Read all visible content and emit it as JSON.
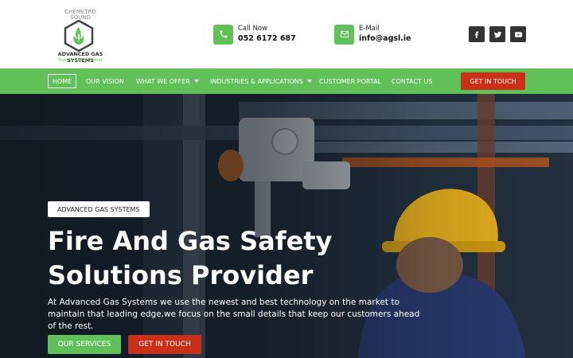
{
  "logo": {
    "badge_text": "CHEMETRO SOUND",
    "name": "ADVANCED GAS SYSTEMS",
    "tagline": "Trusted Safety Partner"
  },
  "contact": {
    "phone_label": "Call Now",
    "phone_value": "052 6172 687",
    "email_label": "E-Mail",
    "email_value": "info@agsl.ie"
  },
  "socials": [
    "facebook-icon",
    "twitter-icon",
    "youtube-icon"
  ],
  "nav": {
    "items": [
      "HOME",
      "OUR VISION",
      "WHAT WE OFFER",
      "INDUSTRIES & APPLICATIONS",
      "CUSTOMER PORTAL",
      "CONTACT US"
    ],
    "cta": "GET IN TOUCH"
  },
  "hero": {
    "badge": "ADVANCED GAS SYSTEMS",
    "title": "Fire And Gas Safety Solutions Provider",
    "subtitle": "At Advanced Gas Systems we use the newest and best technology on the market to maintain that leading edge,we focus on the small details that keep our customers ahead of the rest.",
    "btn_services": "OUR SERVICES",
    "btn_touch": "GET IN TOUCH"
  },
  "colors": {
    "green": "#62c05a",
    "red": "#c9301a",
    "dark": "#333333"
  }
}
